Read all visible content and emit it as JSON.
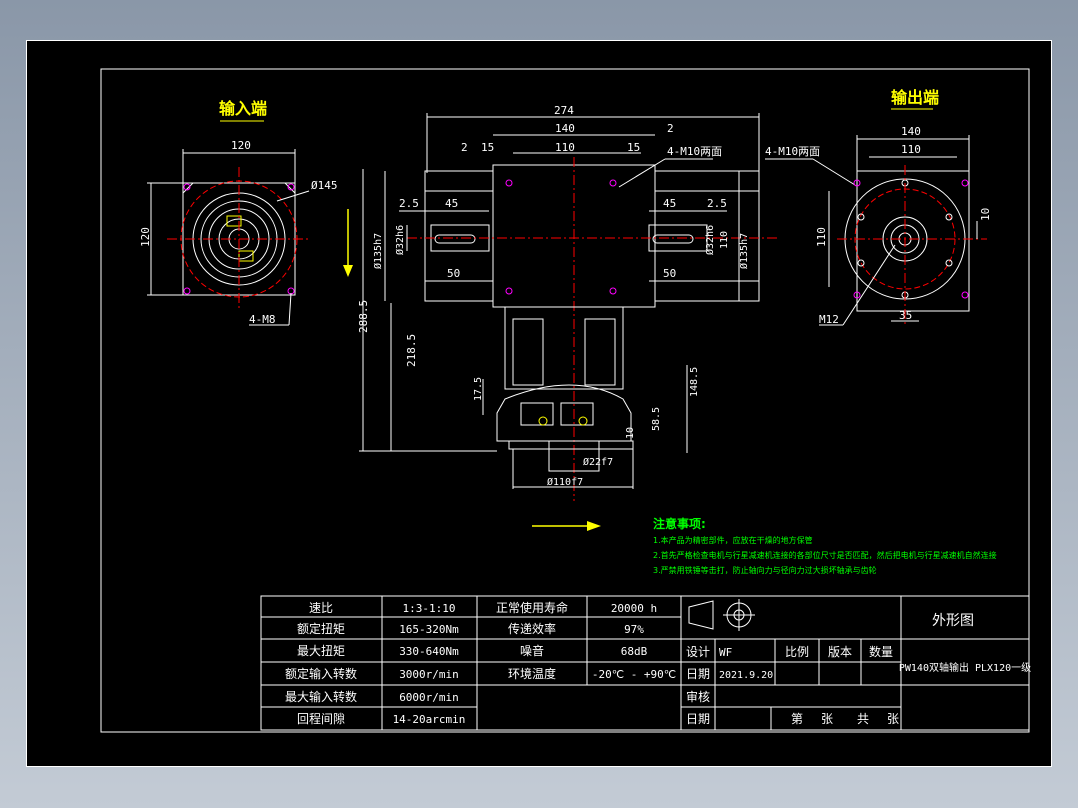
{
  "views": {
    "input_title": "输入端",
    "output_title": "输出端"
  },
  "dims": {
    "overall_width": "274",
    "width_140_top": "140",
    "two_top": "2",
    "two_left": "2",
    "fifteen_left": "15",
    "one_ten_top": "110",
    "fifteen_right": "15",
    "m10_left_note": "4-M10两面",
    "m10_right_note": "4-M10两面",
    "dim_2_5_left": "2.5",
    "dim_45_left": "45",
    "dim_45_right": "45",
    "dim_2_5_right": "2.5",
    "dim_50_left": "50",
    "dim_50_right": "50",
    "dia_135_left": "Ø135h7",
    "dia_32_left": "Ø32h6",
    "dia_32_right": "Ø32h6",
    "dia_135_right": "Ø135h7",
    "dim_110_v": "110",
    "dim_288_5": "288.5",
    "dim_218_5": "218.5",
    "dim_17_5": "17.5",
    "dim_148_5": "148.5",
    "dim_58_5": "58.5",
    "dim_10_v": "10",
    "dia_22": "Ø22f7",
    "dia_110": "Ø110f7",
    "in_120_h": "120",
    "in_120_v": "120",
    "in_dia_145": "Ø145",
    "in_4m8": "4-M8",
    "out_140": "140",
    "out_110": "110",
    "out_110_v": "110",
    "out_10": "10",
    "out_35": "35",
    "out_m12": "M12",
    "out_4m10": "4-M10两面"
  },
  "notes": {
    "heading": "注意事项:",
    "line1": "1.本产品为精密部件，应放在干燥的地方保管",
    "line2": "2.首先严格检查电机与行星减速机连接的各部位尺寸是否匹配，然后把电机与行星减速机自然连接",
    "line3": "3.严禁用铁锤等击打，防止轴向力与径向力过大损坏轴承与齿轮"
  },
  "specs": [
    {
      "label": "速比",
      "value": "1:3-1:10"
    },
    {
      "label": "额定扭矩",
      "value": "165-320Nm"
    },
    {
      "label": "最大扭矩",
      "value": "330-640Nm"
    },
    {
      "label": "额定输入转数",
      "value": "3000r/min"
    },
    {
      "label": "最大输入转数",
      "value": "6000r/min"
    },
    {
      "label": "回程间隙",
      "value": "14-20arcmin"
    }
  ],
  "specs2": [
    {
      "label": "正常使用寿命",
      "value": "20000 h"
    },
    {
      "label": "传递效率",
      "value": "97%"
    },
    {
      "label": "噪音",
      "value": "68dB"
    },
    {
      "label": "环境温度",
      "value": "-20℃ - +90℃"
    }
  ],
  "title_block": {
    "drawing_type": "外形图",
    "design_label": "设计",
    "designer": "WF",
    "date_label": "日期",
    "date": "2021.9.20",
    "review_label": "审核",
    "date2_label": "日期",
    "scale_label": "比例",
    "version_label": "版本",
    "qty_label": "数量",
    "product": "PW140双轴输出 PLX120一级",
    "sheet_di": "第",
    "sheet_zhang1": "张",
    "sheet_gong": "共",
    "sheet_zhang2": "张"
  },
  "colors": {
    "background": "#000000",
    "line": "#ffffff",
    "title_text": "#ffff00",
    "notes_text": "#00ff00",
    "center_line": "#ff0000",
    "holes": "#ff00ff"
  }
}
